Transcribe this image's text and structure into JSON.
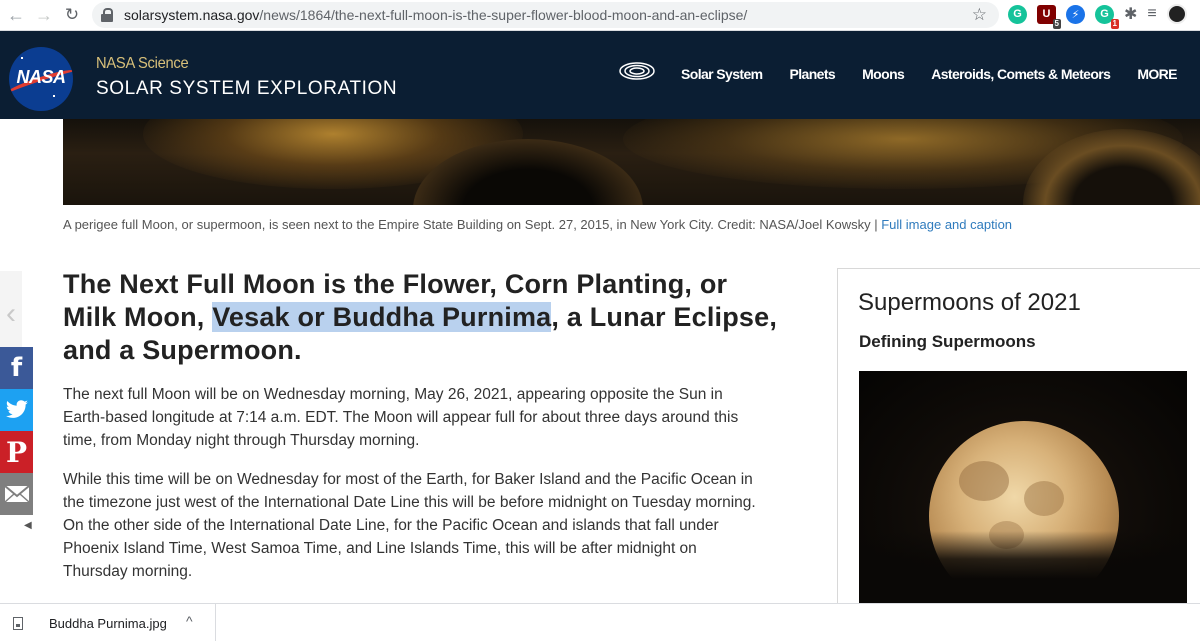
{
  "browser": {
    "back_icon": "←",
    "forward_icon": "→",
    "reload_icon": "↻",
    "url_host": "solarsystem.nasa.gov",
    "url_path": "/news/1864/the-next-full-moon-is-the-super-flower-blood-moon-and-an-eclipse/",
    "star_icon": "☆",
    "extensions": [
      {
        "name": "grammarly-extension-icon",
        "glyph": "G",
        "color": "#15c39a",
        "badge": ""
      },
      {
        "name": "shield-extension-icon",
        "glyph": "U",
        "color": "#800000",
        "badge": "5"
      },
      {
        "name": "bolt-extension-icon",
        "glyph": "⚡",
        "color": "#1a73e8",
        "badge": ""
      },
      {
        "name": "g-badge-extension-icon",
        "glyph": "G",
        "color": "#15c39a",
        "badge": "1"
      }
    ],
    "puzzle_icon": "✱",
    "menu_icon": "≡"
  },
  "site": {
    "logo_text": "NASA",
    "brand_top": "NASA Science",
    "brand_bottom": "SOLAR SYSTEM EXPLORATION",
    "nav": [
      "Solar System",
      "Planets",
      "Moons",
      "Asteroids, Comets & Meteors",
      "MORE"
    ]
  },
  "hero": {
    "caption": "A perigee full Moon, or supermoon, is seen next to the Empire State Building on Sept. 27, 2015, in New York City. Credit: NASA/Joel Kowsky | ",
    "caption_link": "Full image and caption"
  },
  "share": {
    "left_arrow": "‹",
    "facebook": "f",
    "pinterest": "P",
    "collapse": "◀"
  },
  "article": {
    "title_before": "The Next Full Moon is the Flower, Corn Planting, or Milk Moon, ",
    "title_highlight": "Vesak or Buddha Purnima",
    "title_after": ", a Lunar Eclipse, and a Supermoon.",
    "paragraph1": "The next full Moon will be on Wednesday morning, May 26, 2021, appearing opposite the Sun in Earth-based longitude at 7:14 a.m. EDT. The Moon will appear full for about three days around this time, from Monday night through Thursday morning.",
    "paragraph2": "While this time will be on Wednesday for most of the Earth, for Baker Island and the Pacific Ocean in the timezone just west of the International Date Line this will be before midnight on Tuesday morning. On the other side of the International Date Line, for the Pacific Ocean and islands that fall under Phoenix Island Time, West Samoa Time, and Line Islands Time, this will be after midnight on Thursday morning."
  },
  "sidebar": {
    "title": "Supermoons of 2021",
    "subtitle": "Defining Supermoons"
  },
  "download": {
    "filename": "Buddha Purnima.jpg",
    "chevron": "^"
  }
}
